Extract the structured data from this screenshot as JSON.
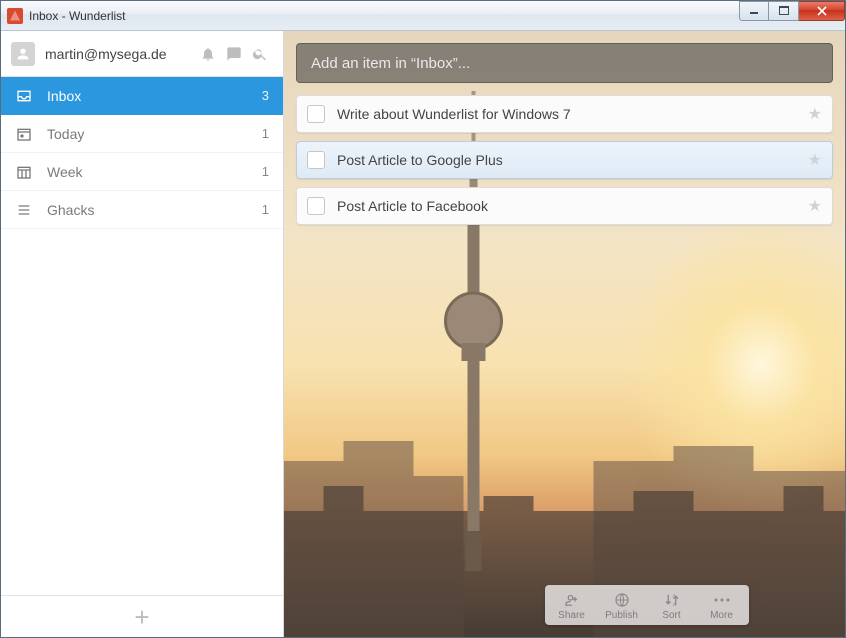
{
  "window": {
    "title": "Inbox - Wunderlist"
  },
  "user": {
    "email": "martin@mysega.de"
  },
  "sidebar": {
    "items": [
      {
        "name": "Inbox",
        "count": "3",
        "icon": "inbox",
        "active": true
      },
      {
        "name": "Today",
        "count": "1",
        "icon": "calendar",
        "active": false
      },
      {
        "name": "Week",
        "count": "1",
        "icon": "week",
        "active": false
      },
      {
        "name": "Ghacks",
        "count": "1",
        "icon": "list",
        "active": false
      }
    ]
  },
  "main": {
    "add_placeholder": "Add an item in “Inbox”...",
    "tasks": [
      {
        "title": "Write about Wunderlist for Windows 7",
        "selected": false
      },
      {
        "title": "Post Article to Google Plus",
        "selected": true
      },
      {
        "title": "Post Article to Facebook",
        "selected": false
      }
    ]
  },
  "toolbar": {
    "share": "Share",
    "publish": "Publish",
    "sort": "Sort",
    "more": "More"
  },
  "colors": {
    "accent": "#2b97de"
  }
}
